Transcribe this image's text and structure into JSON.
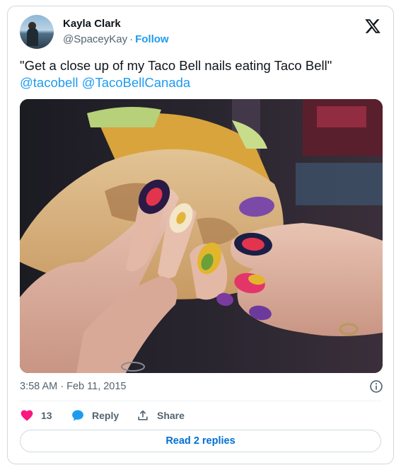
{
  "author": {
    "name": "Kayla Clark",
    "handle": "@SpaceyKay",
    "separator": "·",
    "follow_label": "Follow"
  },
  "tweet": {
    "text": "\"Get a close up of my Taco Bell nails eating Taco Bell\"",
    "mentions": [
      "@tacobell",
      "@TacoBellCanada"
    ]
  },
  "media": {
    "description_icon": "photo",
    "alt": "Hands with Taco Bell themed nail art holding a taco"
  },
  "meta": {
    "timestamp": "3:58 AM · Feb 11, 2015"
  },
  "actions": {
    "like_count": "13",
    "reply_label": "Reply",
    "share_label": "Share"
  },
  "footer": {
    "read_replies_label": "Read 2 replies"
  },
  "colors": {
    "accent": "#1d9bf0",
    "like": "#f91880",
    "link_button": "#006fd6"
  }
}
